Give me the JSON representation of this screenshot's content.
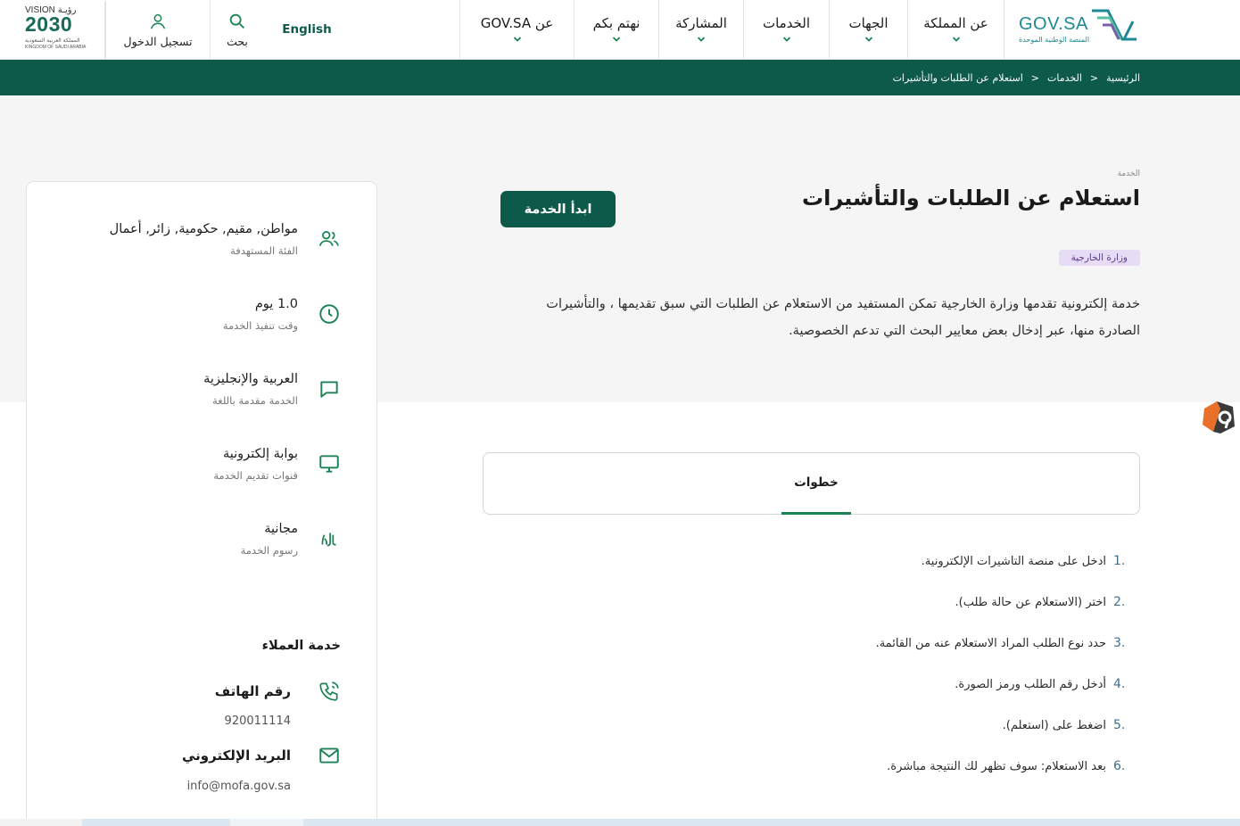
{
  "header": {
    "nav": [
      {
        "label": "عن المملكة"
      },
      {
        "label": "الجهات"
      },
      {
        "label": "الخدمات"
      },
      {
        "label": "المشاركة"
      },
      {
        "label": "نهتم بكم"
      },
      {
        "label": "عن GOV.SA"
      }
    ],
    "language": "English",
    "search_label": "بحث",
    "login_label": "تسجيل الدخول",
    "logo_text": "GOV.SA",
    "logo_subtitle": "المنصة الوطنية الموحدة",
    "vision_top": "VISION رؤيـة",
    "vision_year": "2030",
    "vision_ar": "المملكة العربية السعودية",
    "vision_en": "KINGDOM OF SAUDI ARABIA"
  },
  "breadcrumb": {
    "items": [
      "الرئيسية",
      "الخدمات",
      "استعلام عن الطلبات والتأشيرات"
    ],
    "separator": ">"
  },
  "service": {
    "tag": "الخدمة",
    "title": "استعلام عن الطلبات والتأشيرات",
    "start_button": "ابدأ الخدمة",
    "agency": "وزارة الخارجية",
    "description": "خدمة إلكترونية تقدمها وزارة الخارجية تمكن المستفيد من الاستعلام عن الطلبات التي سبق تقديمها ، والتأشيرات الصادرة منها، عبر إدخال بعض معايير البحث التي تدعم الخصوصية."
  },
  "details": {
    "audience": {
      "value": "مواطن, مقيم, حكومية, زائر, أعمال",
      "label": "الفئة المستهدفة",
      "icon": "users-icon"
    },
    "duration": {
      "value": "1.0 يوم",
      "label": "وقت تنفيذ الخدمة",
      "icon": "clock-icon"
    },
    "language": {
      "value": "العربية والإنجليزية",
      "label": "الخدمة مقدمة باللغة",
      "icon": "chat-icon"
    },
    "channel": {
      "value": "بوابة إلكترونية",
      "label": "قنوات تقديم الخدمة",
      "icon": "monitor-icon"
    },
    "fees": {
      "value": "مجانية",
      "label": "رسوم الخدمة",
      "icon": "riyal-icon"
    }
  },
  "customer_service": {
    "title": "خدمة العملاء",
    "phone_label": "رقم الهاتف",
    "phone": "920011114",
    "email_label": "البريد الإلكتروني",
    "email": "info@mofa.gov.sa"
  },
  "tabs": [
    {
      "label": "خطوات",
      "active": true
    }
  ],
  "steps": [
    {
      "num": "1.",
      "text": "ادخل على منصة التاشيرات الإلكترونية."
    },
    {
      "num": "2.",
      "text": "اختر (الاستعلام عن حالة طلب)."
    },
    {
      "num": "3.",
      "text": "حدد نوع الطلب المراد الاستعلام عنه من القائمة."
    },
    {
      "num": "4.",
      "text": "أدخل رقم الطلب ورمز الصورة."
    },
    {
      "num": "5.",
      "text": "اضغط على (استعلم)."
    },
    {
      "num": "6.",
      "text": "بعد الاستعلام: سوف تظهر لك النتيجة مباشرة."
    }
  ],
  "colors": {
    "primary": "#0d5a4a",
    "accent": "#1b8354",
    "agency_bg": "#e6dcf6"
  }
}
